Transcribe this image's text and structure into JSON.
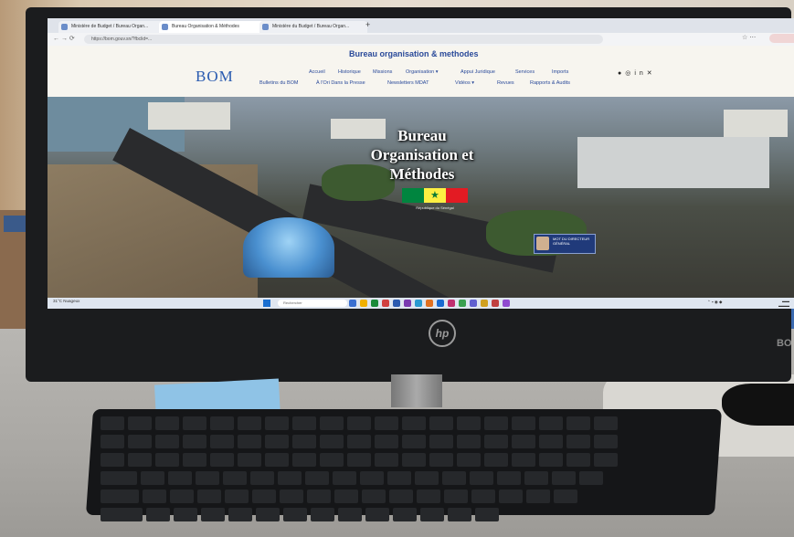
{
  "browser": {
    "tabs": [
      {
        "label": "Ministère de Budget / Bureau Organ..."
      },
      {
        "label": "Bureau Organisation & Méthodes"
      },
      {
        "label": "Ministère du Budget / Bureau Organ..."
      }
    ],
    "new_tab": "+",
    "url": "https://bom.gouv.sn/?fbclid=..."
  },
  "site": {
    "title": "Bureau organisation & methodes",
    "logo": "BOM",
    "nav": {
      "row1": [
        "Accueil",
        "Historique",
        "Missions",
        "Organisation ▾",
        "Appui Juridique",
        "Services",
        "Imports"
      ],
      "row2": [
        "Bulletins du BOM",
        "À l'Ori Dans la Presse",
        "Newsletters MDAT",
        "Vidéos ▾",
        "Revues",
        "Rapports & Audits"
      ]
    },
    "social_icons": [
      "facebook-icon",
      "instagram-icon",
      "linkedin-icon",
      "x-icon"
    ]
  },
  "hero": {
    "title_lines": [
      "Bureau",
      "Organisation et",
      "Méthodes"
    ],
    "flag_caption": "République du Sénégal",
    "dg_card": "MOT DU DIRECTEUR GÉNÉRAL"
  },
  "taskbar": {
    "weather": "31°C Nuageux",
    "search_placeholder": "Rechercher"
  },
  "device": {
    "brand": "hp",
    "speaker_brand": "BO"
  },
  "colors": {
    "site_blue": "#2a4a9a",
    "flag_green": "#00853f",
    "flag_yellow": "#fdef42",
    "flag_red": "#e31b23"
  }
}
